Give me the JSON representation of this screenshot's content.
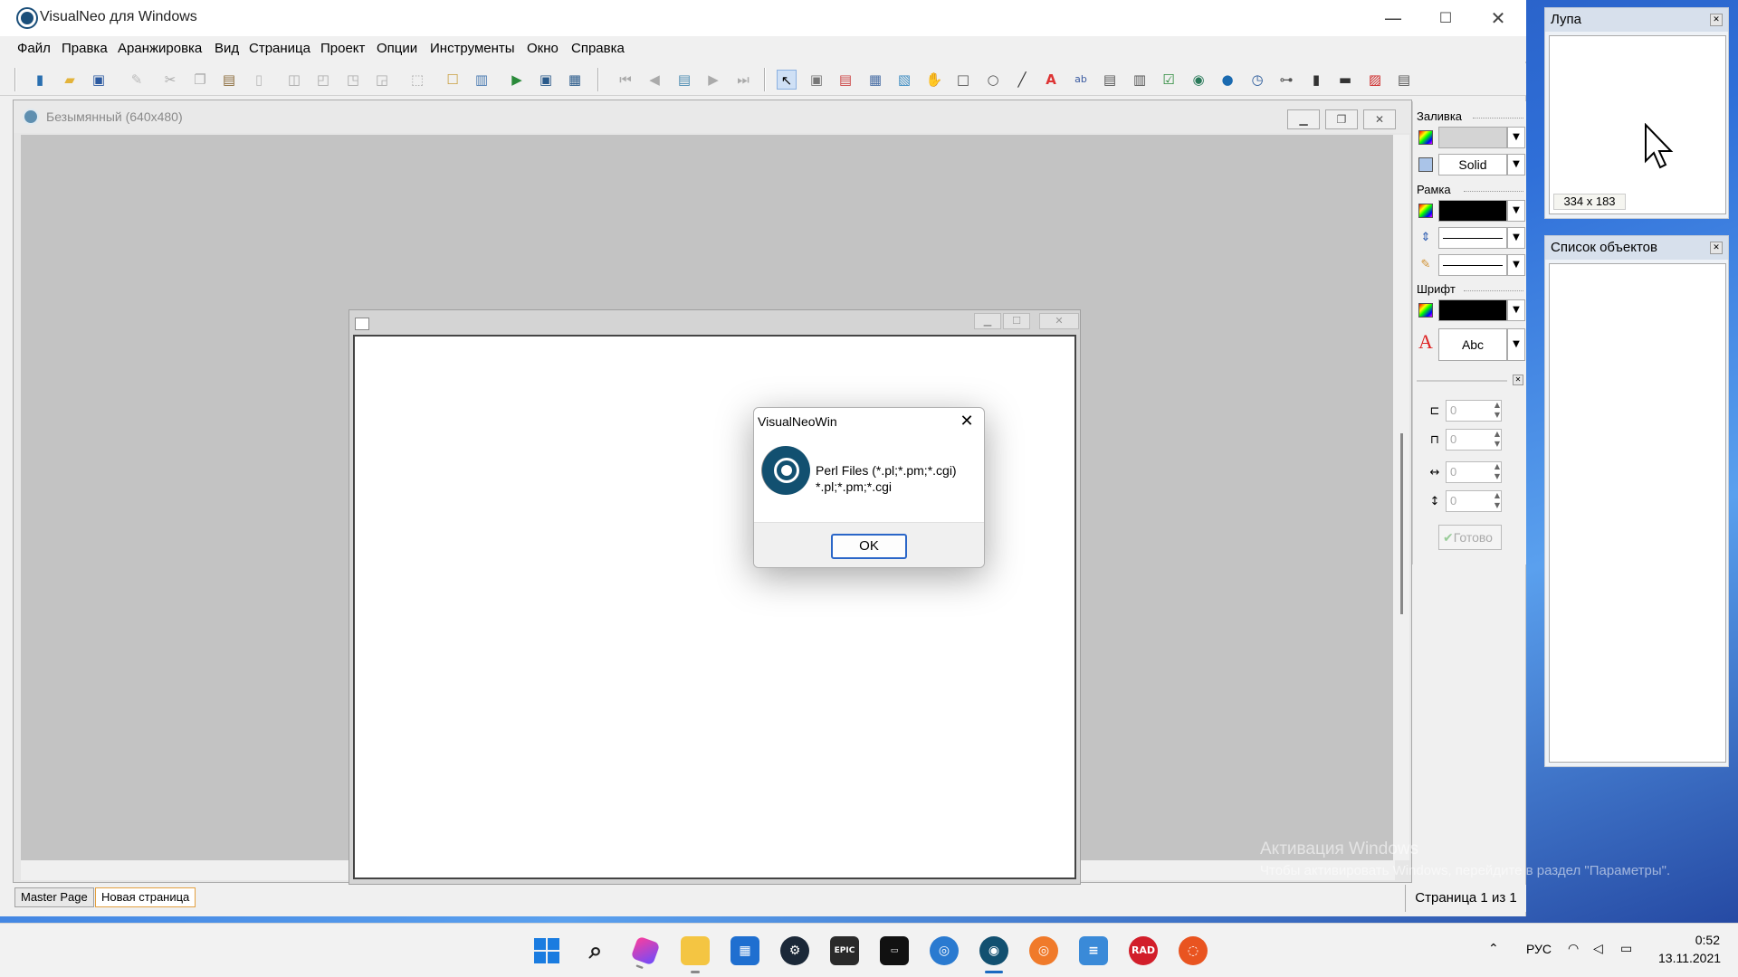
{
  "app": {
    "title": "VisualNeo для Windows",
    "window_buttons": {
      "minimize": "—",
      "maximize": "☐",
      "close": "✕"
    }
  },
  "menu": [
    "Файл",
    "Правка",
    "Аранжировка",
    "Вид",
    "Страница",
    "Проект",
    "Опции",
    "Инструменты",
    "Окно",
    "Справка"
  ],
  "document": {
    "title": "Безымянный (640x480)",
    "buttons": {
      "minimize": "▁",
      "restore": "❐",
      "close": "✕"
    }
  },
  "page_tabs": [
    "Master Page",
    "Новая страница"
  ],
  "active_page_tab": 1,
  "status": {
    "page": "Страница 1 из 1"
  },
  "properties": {
    "fill_label": "Заливка",
    "fill_style": "Solid",
    "border_label": "Рамка",
    "font_label": "Шрифт",
    "font_sample": "Abc",
    "left": "0",
    "top": "0",
    "width": "0",
    "height": "0",
    "done_button": "Готово",
    "colors": {
      "fill": "#d4d4d4",
      "border": "#000000",
      "font": "#000000"
    }
  },
  "loupe": {
    "title": "Лупа",
    "size": "334 x 183"
  },
  "objects_panel": {
    "title": "Список объектов"
  },
  "dialog": {
    "title": "VisualNeoWin",
    "message_line1": "Perl Files (*.pl;*.pm;*.cgi)",
    "message_line2": "*.pl;*.pm;*.cgi",
    "ok_label": "OK"
  },
  "watermark": {
    "line1": "Активация Windows",
    "line2": "Чтобы активировать Windows, перейдите в раздел \"Параметры\"."
  },
  "taskbar": {
    "apps": [
      "windows-start",
      "search",
      "gem-app",
      "file-explorer",
      "microsoft-store",
      "steam",
      "epic-games",
      "terminal",
      "browser",
      "visualneo",
      "origin",
      "notes-app",
      "rad-studio",
      "ubuntu"
    ],
    "active_app": "visualneo",
    "tray": {
      "language": "РУС",
      "time": "0:52",
      "date": "13.11.2021"
    }
  }
}
